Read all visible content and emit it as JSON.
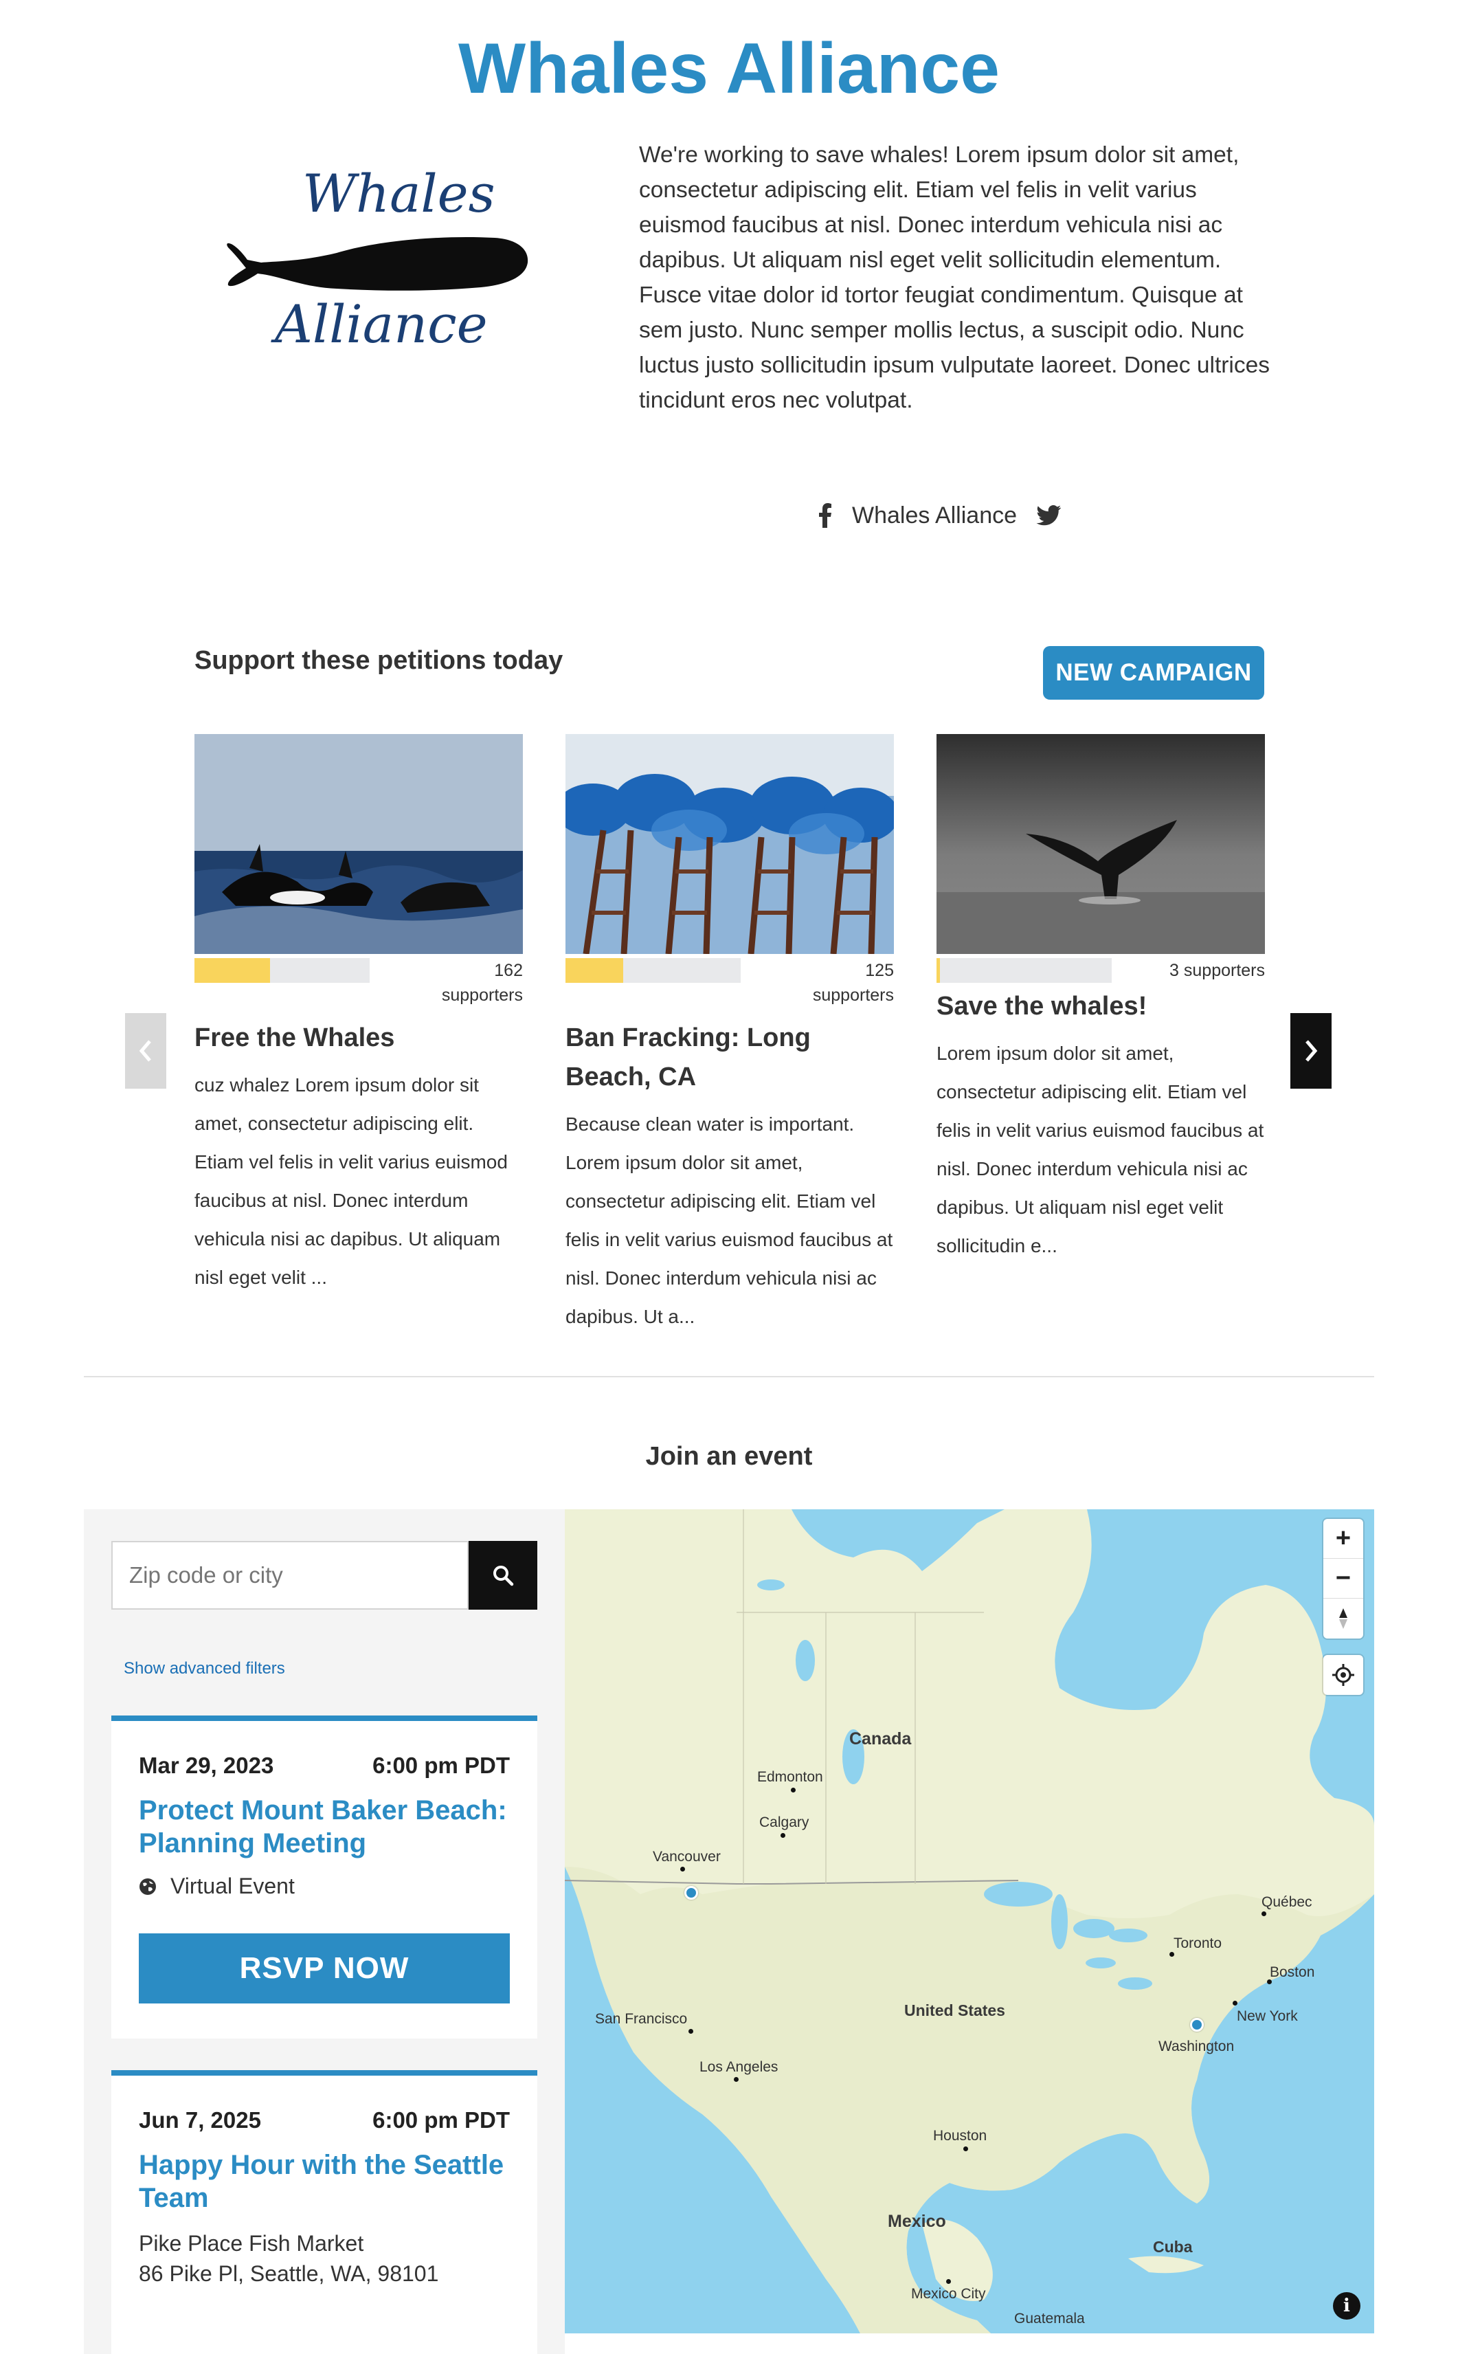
{
  "header": {
    "title": "Whales Alliance"
  },
  "logo": {
    "line1": "Whales",
    "line2": "Alliance"
  },
  "intro": {
    "text": "We're working to save whales! Lorem ipsum dolor sit amet, consectetur adipiscing elit. Etiam vel felis in velit varius euismod faucibus at nisl. Donec interdum vehicula nisi ac dapibus. Ut aliquam nisl eget velit sollicitudin elementum. Fusce vitae dolor id tortor feugiat condimentum. Quisque at sem justo. Nunc semper mollis lectus, a suscipit odio. Nunc luctus justo sollicitudin ipsum vulputate laoreet. Donec ultrices tincidunt eros nec volutpat."
  },
  "social": {
    "name": "Whales Alliance",
    "facebook_icon": "facebook-icon",
    "twitter_icon": "twitter-icon"
  },
  "petitions": {
    "heading": "Support these petitions today",
    "new_campaign_label": "NEW CAMPAIGN",
    "cards": [
      {
        "title": "Free the Whales",
        "count": "162",
        "supporters_label": "supporters",
        "progress": 0.43,
        "description": "cuz whalez Lorem ipsum dolor sit amet, consectetur adipiscing elit. Etiam vel felis in velit varius euismod faucibus at nisl. Donec interdum vehicula nisi ac dapibus. Ut aliquam nisl eget velit ..."
      },
      {
        "title": "Ban Fracking: Long Beach, CA",
        "count": "125",
        "supporters_label": "supporters",
        "progress": 0.33,
        "description": "Because clean water is important. Lorem ipsum dolor sit amet, consectetur adipiscing elit. Etiam vel felis in velit varius euismod faucibus at nisl. Donec interdum vehicula nisi ac dapibus. Ut a..."
      },
      {
        "title": "Save the whales!",
        "count": "3 supporters",
        "progress": 0.02,
        "description": "Lorem ipsum dolor sit amet, consectetur adipiscing elit. Etiam vel felis in velit varius euismod faucibus at nisl. Donec interdum vehicula nisi ac dapibus. Ut aliquam nisl eget velit sollicitudin e..."
      }
    ]
  },
  "events": {
    "heading": "Join an event",
    "search_placeholder": "Zip code or city",
    "advanced_filters_label": "Show advanced filters",
    "items": [
      {
        "date": "Mar 29, 2023",
        "time": "6:00 pm PDT",
        "title": "Protect Mount Baker Beach: Planning Meeting",
        "location": "Virtual Event",
        "rsvp_label": "RSVP NOW"
      },
      {
        "date": "Jun 7, 2025",
        "time": "6:00 pm PDT",
        "title": "Happy Hour with the Seattle Team",
        "address_line1": "Pike Place Fish Market",
        "address_line2": "86 Pike Pl, Seattle, WA, 98101"
      }
    ]
  },
  "map": {
    "zoom_in": "+",
    "zoom_out": "−",
    "info": "i",
    "labels": {
      "canada": "Canada",
      "united_states": "United States",
      "mexico": "Mexico",
      "cuba": "Cuba",
      "edmonton": "Edmonton",
      "calgary": "Calgary",
      "vancouver": "Vancouver",
      "san_francisco": "San Francisco",
      "los_angeles": "Los Angeles",
      "houston": "Houston",
      "toronto": "Toronto",
      "quebec": "Québec",
      "boston": "Boston",
      "new_york": "New York",
      "washington": "Washington",
      "mexico_city": "Mexico City",
      "guatemala": "Guatemala"
    }
  },
  "colors": {
    "accent": "#2b8cc4",
    "progress_fill": "#f9d45c",
    "panel_bg": "#f4f4f4"
  }
}
